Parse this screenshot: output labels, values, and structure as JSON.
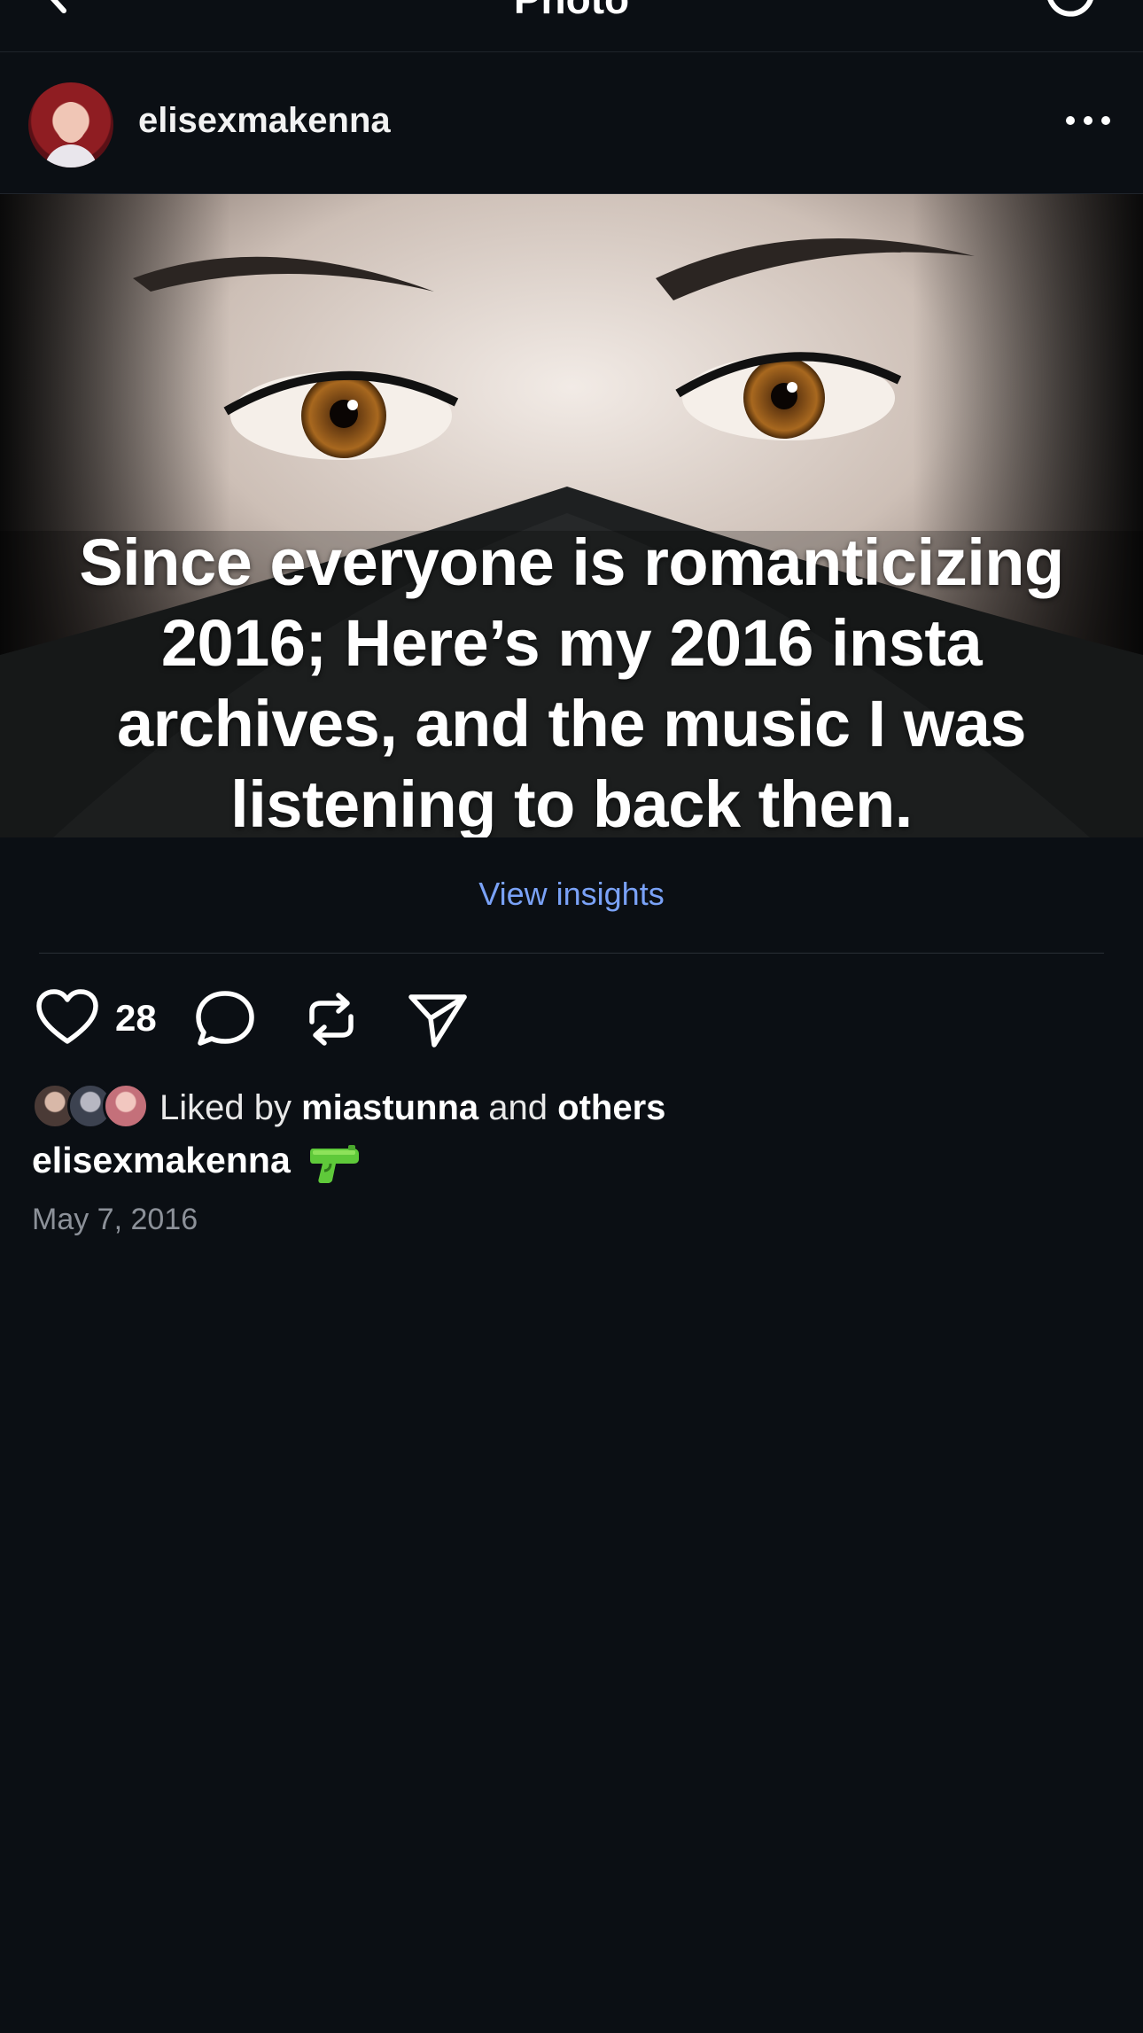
{
  "topbar": {
    "title": "Photo",
    "back_icon": "chevron-left-icon",
    "refresh_icon": "refresh-icon"
  },
  "post": {
    "username": "elisexmakenna",
    "more_icon": "more-horizontal-icon",
    "overlay_text": "Since everyone is romanticizing 2016; Here’s my 2016 insta archives, and the music I was listening to back then.",
    "view_insights": "View insights",
    "like_count": "28",
    "liked_by_prefix": "Liked by",
    "liked_by_user": "miastunna",
    "liked_by_and": "and",
    "liked_by_others": "others",
    "caption_user": "elisexmakenna",
    "caption_emoji": "water-pistol",
    "date": "May 7, 2016"
  },
  "colors": {
    "background": "#0b0f14",
    "link": "#7aa2f7",
    "muted": "#8c9199"
  }
}
